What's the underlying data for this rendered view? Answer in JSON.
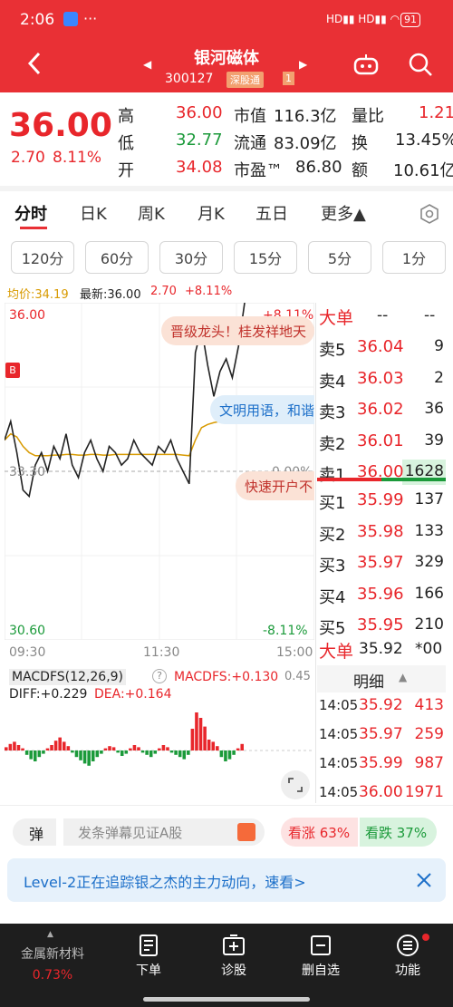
{
  "status": {
    "time": "2:06",
    "battery": "91"
  },
  "header": {
    "title": "银河磁体",
    "code": "300127",
    "market": "深股通",
    "flag": "1"
  },
  "quote": {
    "price": "36.00",
    "change": "2.70",
    "pct": "8.11%",
    "high_label": "高",
    "high": "36.00",
    "low_label": "低",
    "low": "32.77",
    "open_label": "开",
    "open": "34.08",
    "mcap_label": "市值",
    "mcap": "116.3亿",
    "float_label": "流通",
    "float": "83.09亿",
    "pe_label": "市盈™",
    "pe": "86.80",
    "vr_label": "量比",
    "vr": "1.21",
    "turn_label": "换",
    "turn": "13.45%",
    "amt_label": "额",
    "amt": "10.61亿"
  },
  "tabs": [
    "分时",
    "日K",
    "周K",
    "月K",
    "五日",
    "更多▲"
  ],
  "periods": [
    "120分",
    "60分",
    "30分",
    "15分",
    "5分",
    "1分"
  ],
  "chart_info": {
    "avg": "均价:34.19",
    "latest": "最新:36.00",
    "chg": "2.70",
    "pct": "+8.11%"
  },
  "chart_labels": {
    "ymax": "36.00",
    "ymid": "33.30",
    "ymin": "30.60",
    "pmax": "+8.11%",
    "pmid": "0.00%",
    "pmin": "-8.11%",
    "t1": "09:30",
    "t2": "11:30",
    "t3": "15:00",
    "b": "B"
  },
  "bubbles": [
    "晋级龙头！桂发祥地天",
    "文明用语，和谐",
    "快速开户不"
  ],
  "macd": {
    "title": "MACDFS(12,26,9)",
    "help": "?",
    "value": "MACDFS:+0.130",
    "diff": "DIFF:+0.229",
    "dea": "DEA:+0.164",
    "scale": "0.45"
  },
  "orderbook": {
    "big": "大单",
    "dash1": "--",
    "dash2": "--",
    "asks": [
      {
        "l": "卖5",
        "p": "36.04",
        "v": "9"
      },
      {
        "l": "卖4",
        "p": "36.03",
        "v": "2"
      },
      {
        "l": "卖3",
        "p": "36.02",
        "v": "36"
      },
      {
        "l": "卖2",
        "p": "36.01",
        "v": "39"
      },
      {
        "l": "卖1",
        "p": "36.00",
        "v": "1628"
      }
    ],
    "bids": [
      {
        "l": "买1",
        "p": "35.99",
        "v": "137"
      },
      {
        "l": "买2",
        "p": "35.98",
        "v": "133"
      },
      {
        "l": "买3",
        "p": "35.97",
        "v": "329"
      },
      {
        "l": "买4",
        "p": "35.96",
        "v": "166"
      },
      {
        "l": "买5",
        "p": "35.95",
        "v": "210"
      }
    ],
    "big2": "大单",
    "big2p": "35.92",
    "big2v": "*00",
    "detail": "明细",
    "detail_arrow": "▲",
    "ticks": [
      {
        "t": "14:05",
        "p": "35.92",
        "v": "413"
      },
      {
        "t": "14:05",
        "p": "35.97",
        "v": "259"
      },
      {
        "t": "14:05",
        "p": "35.99",
        "v": "987"
      },
      {
        "t": "14:05",
        "p": "36.00",
        "v": "1971"
      }
    ]
  },
  "comment": {
    "icon": "弹",
    "placeholder": "发条弹幕见证A股",
    "up": "看涨 63%",
    "down": "看跌 37%"
  },
  "banner": {
    "text": "Level-2正在追踪银之杰的主力动向，速看>"
  },
  "nav": {
    "sector": "金属新材料",
    "sector_pct": "0.73%",
    "items": [
      "下单",
      "诊股",
      "删自选",
      "功能"
    ]
  },
  "colors": {
    "red": "#e8262b",
    "green": "#1b9a3a",
    "header": "#e93035",
    "nav": "#1e1e1e"
  },
  "chart_data": {
    "type": "line",
    "x_range": [
      "09:30",
      "15:00"
    ],
    "ylim": [
      30.6,
      36.0
    ],
    "prev_close": 33.3,
    "price": [
      33.8,
      34.1,
      33.6,
      33.0,
      32.9,
      33.4,
      33.6,
      33.3,
      33.7,
      33.5,
      33.9,
      33.4,
      33.2,
      33.6,
      33.8,
      33.5,
      33.3,
      33.7,
      33.6,
      33.4,
      33.5,
      33.8,
      33.6,
      33.5,
      33.4,
      33.7,
      33.6,
      33.8,
      33.5,
      33.3,
      33.1,
      35.2,
      35.6,
      35.0,
      34.5,
      34.9,
      35.1,
      34.8,
      35.3,
      36.0
    ],
    "avg": [
      33.8,
      33.9,
      33.85,
      33.7,
      33.6,
      33.55,
      33.55,
      33.55,
      33.56,
      33.56,
      33.57,
      33.57,
      33.56,
      33.56,
      33.57,
      33.57,
      33.56,
      33.56,
      33.57,
      33.57,
      33.57,
      33.57,
      33.57,
      33.57,
      33.57,
      33.57,
      33.57,
      33.57,
      33.57,
      33.56,
      33.55,
      33.8,
      34.0,
      34.05,
      34.08,
      34.1,
      34.12,
      34.14,
      34.17,
      34.19
    ]
  }
}
